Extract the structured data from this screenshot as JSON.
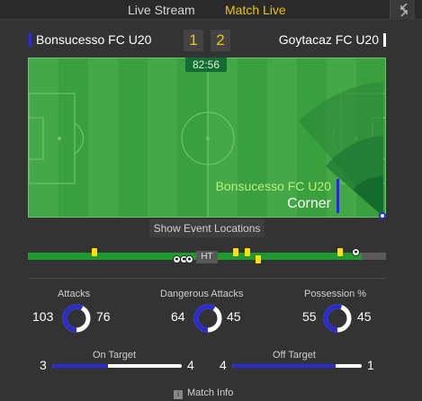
{
  "tabs": {
    "live_stream": "Live Stream",
    "match_live": "Match Live"
  },
  "icons": {
    "expand": "collapse-arrows-icon",
    "info": "info-icon",
    "card": "yellow-card-icon",
    "goal": "football-icon"
  },
  "teams": {
    "home": {
      "name": "Bonsucesso FC U20",
      "score": "1",
      "color": "#2b2bd6"
    },
    "away": {
      "name": "Goytacaz FC U20",
      "score": "2",
      "color": "#ffffff"
    }
  },
  "pitch": {
    "clock": "82:56",
    "event_team": "Bonsucesso FC U20",
    "event_type": "Corner",
    "show_locations": "Show Event Locations"
  },
  "timeline": {
    "ht_label": "HT"
  },
  "stats": {
    "attacks": {
      "label": "Attacks",
      "home": "103",
      "away": "76",
      "home_share": 0.575
    },
    "dangerous_attacks": {
      "label": "Dangerous Attacks",
      "home": "64",
      "away": "45",
      "home_share": 0.587
    },
    "possession": {
      "label": "Possession %",
      "home": "55",
      "away": "45",
      "home_share": 0.55
    }
  },
  "shots": {
    "on_target": {
      "label": "On Target",
      "home": "3",
      "away": "4",
      "home_share": 0.43
    },
    "off_target": {
      "label": "Off Target",
      "home": "4",
      "away": "1",
      "home_share": 0.8
    }
  },
  "footer": {
    "match_info": "Match Info"
  },
  "colors": {
    "accent": "#f0c300",
    "pitch": "#3aa03d",
    "home": "#2b2bd6"
  }
}
